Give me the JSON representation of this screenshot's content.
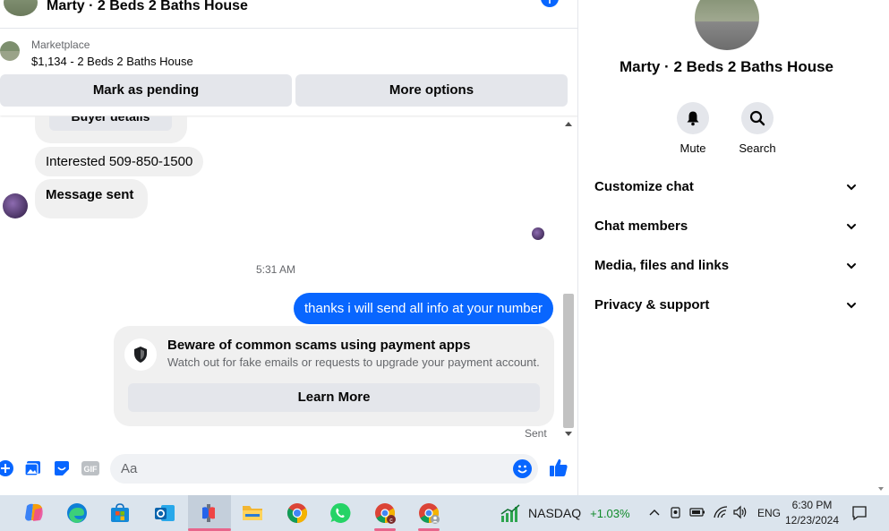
{
  "chat": {
    "header_title": "Marty · 2 Beds 2 Baths House",
    "info_icon": "i",
    "listing": {
      "label": "Marketplace",
      "price_title": "$1,134 - 2 Beds 2 Baths House",
      "pending_button": "Mark as pending",
      "more_button": "More options"
    },
    "messages": {
      "buyer_details": "Buyer details",
      "interested": "Interested 509-850-1500",
      "message_sent": "Message sent",
      "timestamp": "5:31 AM",
      "outgoing": "thanks i will send all info at your number",
      "warning_title": "Beware of common scams using payment apps",
      "warning_sub": "Watch out for fake emails or requests to upgrade your payment account.",
      "learn_more": "Learn More",
      "sent_status": "Sent"
    },
    "composer": {
      "placeholder": "Aa",
      "gif_label": "GIF"
    }
  },
  "info_panel": {
    "title": "Marty · 2 Beds 2 Baths House",
    "actions": [
      {
        "label": "Mute",
        "icon": "bell-icon"
      },
      {
        "label": "Search",
        "icon": "search-icon"
      }
    ],
    "sections": [
      "Customize chat",
      "Chat members",
      "Media, files and links",
      "Privacy & support"
    ]
  },
  "taskbar": {
    "apps": [
      "copilot",
      "edge",
      "store",
      "outlook",
      "sandbox",
      "file-explorer",
      "chrome",
      "whatsapp",
      "chrome-profile-c",
      "chrome-profile-user"
    ],
    "stock_name": "NASDAQ",
    "stock_change": "+1.03%",
    "language": "ENG",
    "time": "6:30 PM",
    "date": "12/23/2024"
  },
  "colors": {
    "messenger_blue": "#0866ff",
    "bubble_gray": "#f0f0f0",
    "button_gray": "#e4e6eb",
    "taskbar": "#dbe4ed",
    "stock_green": "#0f8a2a"
  }
}
